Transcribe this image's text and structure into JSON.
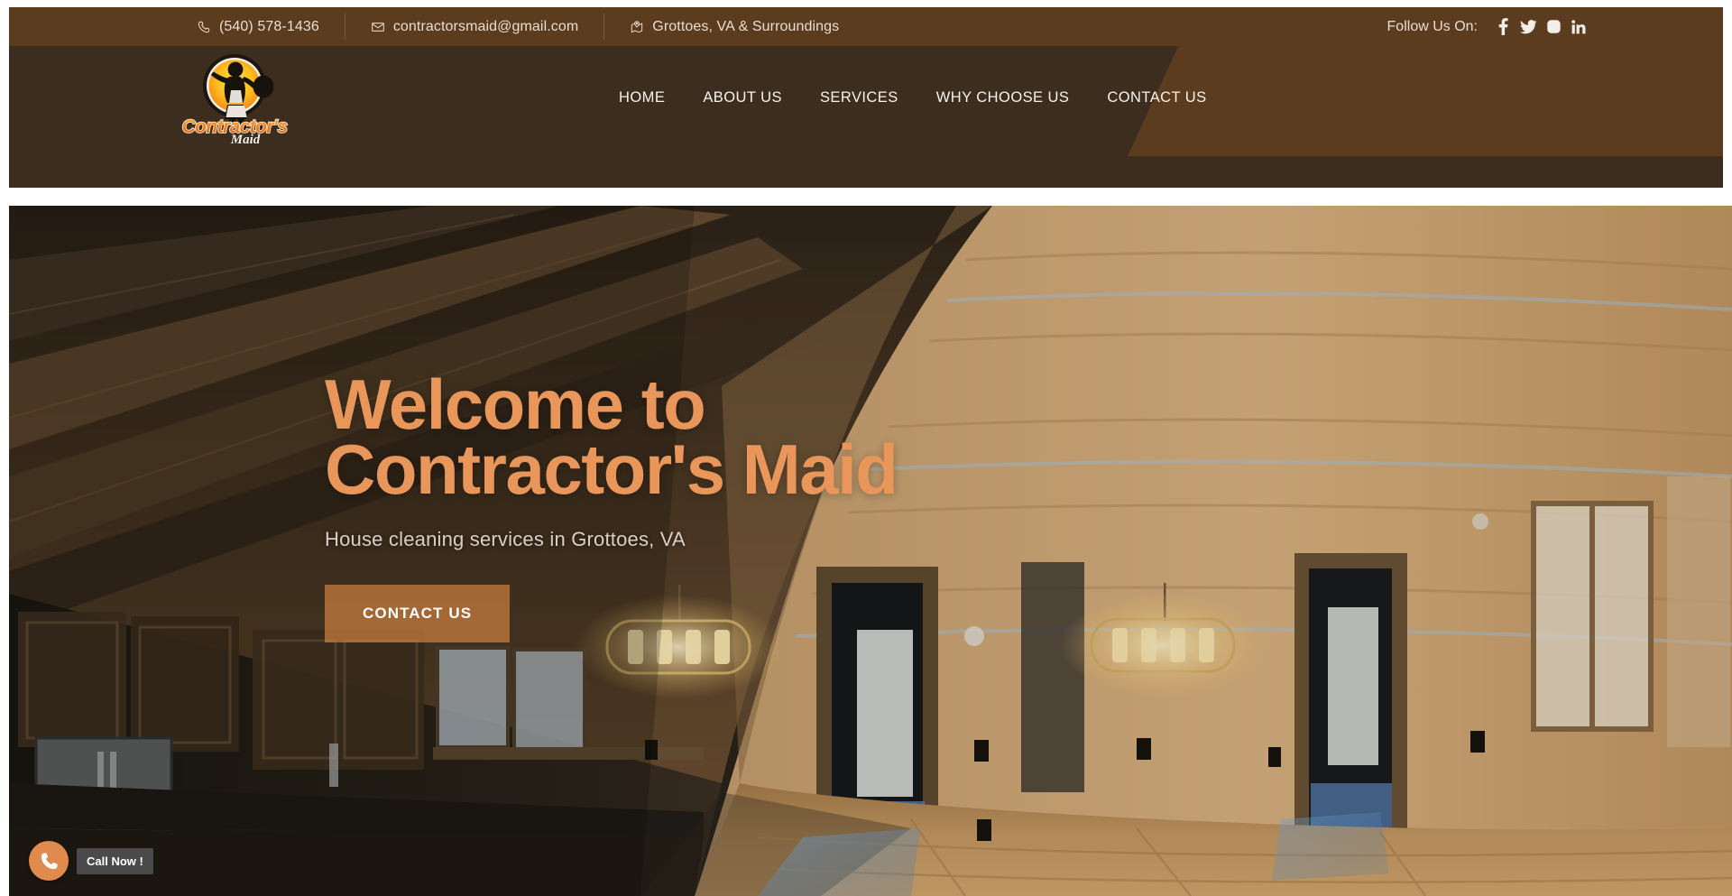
{
  "topbar": {
    "contacts": [
      {
        "icon": "phone-icon",
        "text": "(540) 578-1436"
      },
      {
        "icon": "envelope-icon",
        "text": "contractorsmaid@gmail.com"
      },
      {
        "icon": "location-pin-icon",
        "text": "Grottoes, VA & Surroundings"
      }
    ],
    "follow_label": "Follow Us On:",
    "social": [
      {
        "name": "facebook-icon",
        "label": "Facebook"
      },
      {
        "name": "twitter-icon",
        "label": "Twitter"
      },
      {
        "name": "instagram-icon",
        "label": "Instagram"
      },
      {
        "name": "linkedin-icon",
        "label": "LinkedIn"
      }
    ]
  },
  "header": {
    "logo": {
      "name": "contractors-maid-logo",
      "primary_text": "Contractor's",
      "secondary_text": "Maid"
    },
    "nav": [
      {
        "label": "HOME",
        "name": "nav-home"
      },
      {
        "label": "ABOUT US",
        "name": "nav-about-us"
      },
      {
        "label": "SERVICES",
        "name": "nav-services"
      },
      {
        "label": "WHY CHOOSE US",
        "name": "nav-why-choose-us"
      },
      {
        "label": "CONTACT US",
        "name": "nav-contact-us"
      }
    ]
  },
  "hero": {
    "title_line1": "Welcome to",
    "title_line2": "Contractor's Maid",
    "subtitle": "House cleaning services in Grottoes, VA",
    "cta_label": "CONTACT US"
  },
  "call_widget": {
    "tooltip": "Call Now !",
    "icon": "phone-filled-icon"
  },
  "colors": {
    "topbar_brown": "#5c3c1e",
    "nav_dark_brown": "#3d2d1f",
    "accent_orange": "#e8965a",
    "button_orange": "#e28b46",
    "text_cream": "#e8ddd2",
    "tooltip_gray": "#4a4a4a"
  }
}
